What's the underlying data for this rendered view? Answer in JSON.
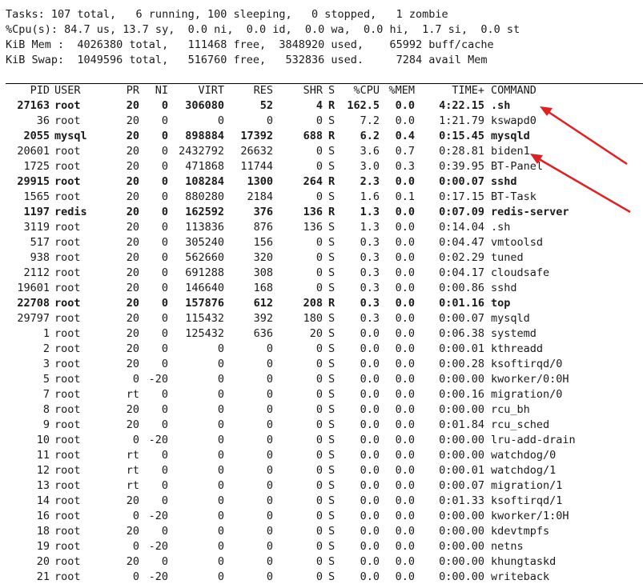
{
  "summary": [
    "Tasks: 107 total,   6 running, 100 sleeping,   0 stopped,   1 zombie",
    "%Cpu(s): 84.7 us, 13.7 sy,  0.0 ni,  0.0 id,  0.0 wa,  0.0 hi,  1.7 si,  0.0 st",
    "KiB Mem :  4026380 total,   111468 free,  3848920 used,    65992 buff/cache",
    "KiB Swap:  1049596 total,   516760 free,   532836 used.     7284 avail Mem"
  ],
  "columns": [
    "PID",
    "USER",
    "PR",
    "NI",
    "VIRT",
    "RES",
    "SHR",
    "S",
    "%CPU",
    "%MEM",
    "TIME+",
    "COMMAND"
  ],
  "processes": [
    {
      "pid": "27163",
      "user": "root",
      "pr": "20",
      "ni": "0",
      "virt": "306080",
      "res": "52",
      "shr": "4",
      "s": "R",
      "cpu": "162.5",
      "mem": "0.0",
      "time": "4:22.15",
      "cmd": ".sh",
      "bold": true
    },
    {
      "pid": "36",
      "user": "root",
      "pr": "20",
      "ni": "0",
      "virt": "0",
      "res": "0",
      "shr": "0",
      "s": "S",
      "cpu": "7.2",
      "mem": "0.0",
      "time": "1:21.79",
      "cmd": "kswapd0",
      "bold": false
    },
    {
      "pid": "2055",
      "user": "mysql",
      "pr": "20",
      "ni": "0",
      "virt": "898884",
      "res": "17392",
      "shr": "688",
      "s": "R",
      "cpu": "6.2",
      "mem": "0.4",
      "time": "0:15.45",
      "cmd": "mysqld",
      "bold": true
    },
    {
      "pid": "20601",
      "user": "root",
      "pr": "20",
      "ni": "0",
      "virt": "2432792",
      "res": "26632",
      "shr": "0",
      "s": "S",
      "cpu": "3.6",
      "mem": "0.7",
      "time": "0:28.81",
      "cmd": "biden1",
      "bold": false
    },
    {
      "pid": "1725",
      "user": "root",
      "pr": "20",
      "ni": "0",
      "virt": "471868",
      "res": "11744",
      "shr": "0",
      "s": "S",
      "cpu": "3.0",
      "mem": "0.3",
      "time": "0:39.95",
      "cmd": "BT-Panel",
      "bold": false
    },
    {
      "pid": "29915",
      "user": "root",
      "pr": "20",
      "ni": "0",
      "virt": "108284",
      "res": "1300",
      "shr": "264",
      "s": "R",
      "cpu": "2.3",
      "mem": "0.0",
      "time": "0:00.07",
      "cmd": "sshd",
      "bold": true
    },
    {
      "pid": "1565",
      "user": "root",
      "pr": "20",
      "ni": "0",
      "virt": "880280",
      "res": "2184",
      "shr": "0",
      "s": "S",
      "cpu": "1.6",
      "mem": "0.1",
      "time": "0:17.15",
      "cmd": "BT-Task",
      "bold": false
    },
    {
      "pid": "1197",
      "user": "redis",
      "pr": "20",
      "ni": "0",
      "virt": "162592",
      "res": "376",
      "shr": "136",
      "s": "R",
      "cpu": "1.3",
      "mem": "0.0",
      "time": "0:07.09",
      "cmd": "redis-server",
      "bold": true
    },
    {
      "pid": "3119",
      "user": "root",
      "pr": "20",
      "ni": "0",
      "virt": "113836",
      "res": "876",
      "shr": "136",
      "s": "S",
      "cpu": "1.3",
      "mem": "0.0",
      "time": "0:14.04",
      "cmd": ".sh",
      "bold": false
    },
    {
      "pid": "517",
      "user": "root",
      "pr": "20",
      "ni": "0",
      "virt": "305240",
      "res": "156",
      "shr": "0",
      "s": "S",
      "cpu": "0.3",
      "mem": "0.0",
      "time": "0:04.47",
      "cmd": "vmtoolsd",
      "bold": false
    },
    {
      "pid": "938",
      "user": "root",
      "pr": "20",
      "ni": "0",
      "virt": "562660",
      "res": "320",
      "shr": "0",
      "s": "S",
      "cpu": "0.3",
      "mem": "0.0",
      "time": "0:02.29",
      "cmd": "tuned",
      "bold": false
    },
    {
      "pid": "2112",
      "user": "root",
      "pr": "20",
      "ni": "0",
      "virt": "691288",
      "res": "308",
      "shr": "0",
      "s": "S",
      "cpu": "0.3",
      "mem": "0.0",
      "time": "0:04.17",
      "cmd": "cloudsafe",
      "bold": false
    },
    {
      "pid": "19601",
      "user": "root",
      "pr": "20",
      "ni": "0",
      "virt": "146640",
      "res": "168",
      "shr": "0",
      "s": "S",
      "cpu": "0.3",
      "mem": "0.0",
      "time": "0:00.86",
      "cmd": "sshd",
      "bold": false
    },
    {
      "pid": "22708",
      "user": "root",
      "pr": "20",
      "ni": "0",
      "virt": "157876",
      "res": "612",
      "shr": "208",
      "s": "R",
      "cpu": "0.3",
      "mem": "0.0",
      "time": "0:01.16",
      "cmd": "top",
      "bold": true
    },
    {
      "pid": "29797",
      "user": "root",
      "pr": "20",
      "ni": "0",
      "virt": "115432",
      "res": "392",
      "shr": "180",
      "s": "S",
      "cpu": "0.3",
      "mem": "0.0",
      "time": "0:00.07",
      "cmd": "mysqld",
      "bold": false
    },
    {
      "pid": "1",
      "user": "root",
      "pr": "20",
      "ni": "0",
      "virt": "125432",
      "res": "636",
      "shr": "20",
      "s": "S",
      "cpu": "0.0",
      "mem": "0.0",
      "time": "0:06.38",
      "cmd": "systemd",
      "bold": false
    },
    {
      "pid": "2",
      "user": "root",
      "pr": "20",
      "ni": "0",
      "virt": "0",
      "res": "0",
      "shr": "0",
      "s": "S",
      "cpu": "0.0",
      "mem": "0.0",
      "time": "0:00.01",
      "cmd": "kthreadd",
      "bold": false
    },
    {
      "pid": "3",
      "user": "root",
      "pr": "20",
      "ni": "0",
      "virt": "0",
      "res": "0",
      "shr": "0",
      "s": "S",
      "cpu": "0.0",
      "mem": "0.0",
      "time": "0:00.28",
      "cmd": "ksoftirqd/0",
      "bold": false
    },
    {
      "pid": "5",
      "user": "root",
      "pr": "0",
      "ni": "-20",
      "virt": "0",
      "res": "0",
      "shr": "0",
      "s": "S",
      "cpu": "0.0",
      "mem": "0.0",
      "time": "0:00.00",
      "cmd": "kworker/0:0H",
      "bold": false
    },
    {
      "pid": "7",
      "user": "root",
      "pr": "rt",
      "ni": "0",
      "virt": "0",
      "res": "0",
      "shr": "0",
      "s": "S",
      "cpu": "0.0",
      "mem": "0.0",
      "time": "0:00.16",
      "cmd": "migration/0",
      "bold": false
    },
    {
      "pid": "8",
      "user": "root",
      "pr": "20",
      "ni": "0",
      "virt": "0",
      "res": "0",
      "shr": "0",
      "s": "S",
      "cpu": "0.0",
      "mem": "0.0",
      "time": "0:00.00",
      "cmd": "rcu_bh",
      "bold": false
    },
    {
      "pid": "9",
      "user": "root",
      "pr": "20",
      "ni": "0",
      "virt": "0",
      "res": "0",
      "shr": "0",
      "s": "S",
      "cpu": "0.0",
      "mem": "0.0",
      "time": "0:01.84",
      "cmd": "rcu_sched",
      "bold": false
    },
    {
      "pid": "10",
      "user": "root",
      "pr": "0",
      "ni": "-20",
      "virt": "0",
      "res": "0",
      "shr": "0",
      "s": "S",
      "cpu": "0.0",
      "mem": "0.0",
      "time": "0:00.00",
      "cmd": "lru-add-drain",
      "bold": false
    },
    {
      "pid": "11",
      "user": "root",
      "pr": "rt",
      "ni": "0",
      "virt": "0",
      "res": "0",
      "shr": "0",
      "s": "S",
      "cpu": "0.0",
      "mem": "0.0",
      "time": "0:00.00",
      "cmd": "watchdog/0",
      "bold": false
    },
    {
      "pid": "12",
      "user": "root",
      "pr": "rt",
      "ni": "0",
      "virt": "0",
      "res": "0",
      "shr": "0",
      "s": "S",
      "cpu": "0.0",
      "mem": "0.0",
      "time": "0:00.01",
      "cmd": "watchdog/1",
      "bold": false
    },
    {
      "pid": "13",
      "user": "root",
      "pr": "rt",
      "ni": "0",
      "virt": "0",
      "res": "0",
      "shr": "0",
      "s": "S",
      "cpu": "0.0",
      "mem": "0.0",
      "time": "0:00.07",
      "cmd": "migration/1",
      "bold": false
    },
    {
      "pid": "14",
      "user": "root",
      "pr": "20",
      "ni": "0",
      "virt": "0",
      "res": "0",
      "shr": "0",
      "s": "S",
      "cpu": "0.0",
      "mem": "0.0",
      "time": "0:01.33",
      "cmd": "ksoftirqd/1",
      "bold": false
    },
    {
      "pid": "16",
      "user": "root",
      "pr": "0",
      "ni": "-20",
      "virt": "0",
      "res": "0",
      "shr": "0",
      "s": "S",
      "cpu": "0.0",
      "mem": "0.0",
      "time": "0:00.00",
      "cmd": "kworker/1:0H",
      "bold": false
    },
    {
      "pid": "18",
      "user": "root",
      "pr": "20",
      "ni": "0",
      "virt": "0",
      "res": "0",
      "shr": "0",
      "s": "S",
      "cpu": "0.0",
      "mem": "0.0",
      "time": "0:00.00",
      "cmd": "kdevtmpfs",
      "bold": false
    },
    {
      "pid": "19",
      "user": "root",
      "pr": "0",
      "ni": "-20",
      "virt": "0",
      "res": "0",
      "shr": "0",
      "s": "S",
      "cpu": "0.0",
      "mem": "0.0",
      "time": "0:00.00",
      "cmd": "netns",
      "bold": false
    },
    {
      "pid": "20",
      "user": "root",
      "pr": "20",
      "ni": "0",
      "virt": "0",
      "res": "0",
      "shr": "0",
      "s": "S",
      "cpu": "0.0",
      "mem": "0.0",
      "time": "0:00.00",
      "cmd": "khungtaskd",
      "bold": false
    },
    {
      "pid": "21",
      "user": "root",
      "pr": "0",
      "ni": "-20",
      "virt": "0",
      "res": "0",
      "shr": "0",
      "s": "S",
      "cpu": "0.0",
      "mem": "0.0",
      "time": "0:00.00",
      "cmd": "writeback",
      "bold": false
    }
  ],
  "annotation_color": "#e02020"
}
